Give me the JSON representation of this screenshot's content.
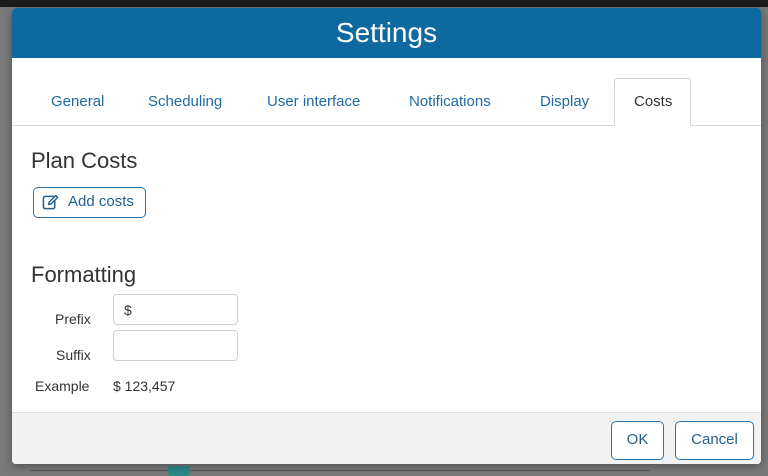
{
  "dialog": {
    "title": "Settings"
  },
  "tabs": [
    {
      "label": "General",
      "active": false
    },
    {
      "label": "Scheduling",
      "active": false
    },
    {
      "label": "User interface",
      "active": false
    },
    {
      "label": "Notifications",
      "active": false
    },
    {
      "label": "Display",
      "active": false
    },
    {
      "label": "Costs",
      "active": true
    }
  ],
  "plan_costs": {
    "heading": "Plan Costs",
    "add_button_label": "Add costs",
    "add_button_icon": "edit-icon"
  },
  "formatting": {
    "heading": "Formatting",
    "prefix_label": "Prefix",
    "prefix_value": "$",
    "suffix_label": "Suffix",
    "suffix_value": "",
    "example_label": "Example",
    "example_value": "$ 123,457"
  },
  "footer": {
    "ok_label": "OK",
    "cancel_label": "Cancel"
  },
  "colors": {
    "titlebar": "#0e69a0",
    "accent": "#1f6aa3"
  }
}
